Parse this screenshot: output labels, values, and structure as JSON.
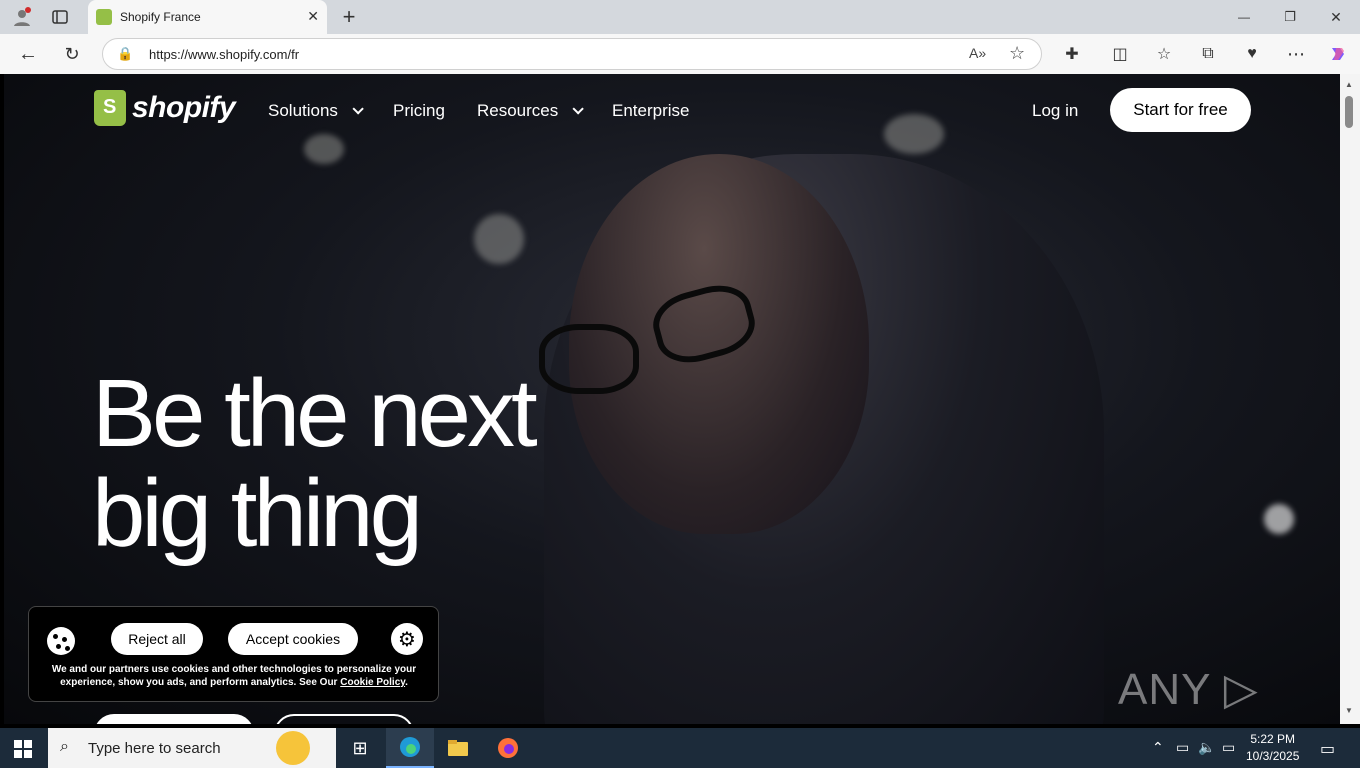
{
  "browser": {
    "tab_title": "Shopify France",
    "tab_close": "✕",
    "new_tab": "+",
    "url": "https://www.shopify.com/fr",
    "window_min": "—",
    "window_restore": "❐",
    "window_close": "✕"
  },
  "nav": {
    "logo": "shopify",
    "items": [
      "Solutions",
      "Pricing",
      "Resources",
      "Enterprise"
    ],
    "login": "Log in",
    "start": "Start for free"
  },
  "hero": {
    "line1": "Be the next",
    "line2": "big thing"
  },
  "cookie": {
    "reject": "Reject all",
    "accept": "Accept cookies",
    "text": "We and our partners use cookies and other technologies to personalize your experience, show you ads, and perform analytics. See Our",
    "policy": "Cookie Policy",
    "period": "."
  },
  "watermark": "ANY ▷ RUN",
  "taskbar": {
    "search_placeholder": "Type here to search",
    "time": "5:22 PM",
    "date": "10/3/2025"
  }
}
